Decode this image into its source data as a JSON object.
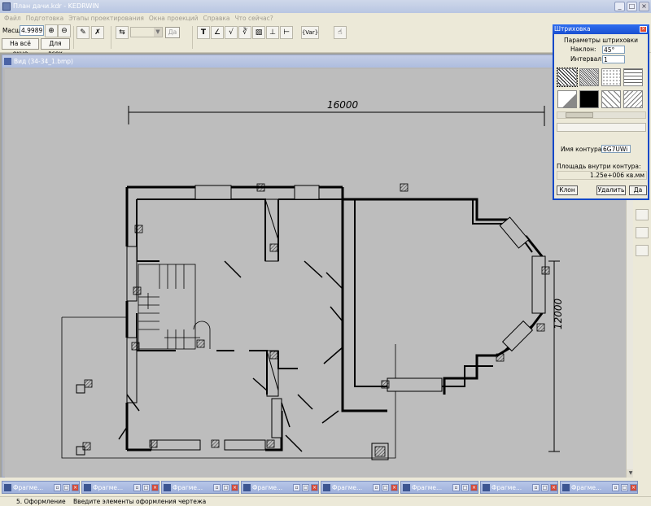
{
  "window": {
    "title": "План дачи.kdr - KEDRWIN"
  },
  "menu": [
    "Файл",
    "Подготовка",
    "Этапы проектирования",
    "Окна проекций",
    "Справка",
    "Что сейчас?"
  ],
  "toolbar": {
    "scale_label": "Масшт",
    "scale_value": "4.9989",
    "on_all_window": "На всё окно",
    "for_all": "Для всех",
    "yes_label": "Да",
    "var_label": "{Var}"
  },
  "document": {
    "title": "Вид (34-34_1.bmp)",
    "dim_horizontal": "16000",
    "dim_vertical": "12000"
  },
  "hatch_dialog": {
    "title": "Штриховка",
    "params_title": "Параметры штриховки",
    "slope_label": "Наклон:",
    "slope_value": "45°",
    "interval_label": "Интервал:",
    "interval_value": "1",
    "contour_name_label": "Имя контура:",
    "contour_name_value": "6G7UWi",
    "area_label": "Площадь внутри контура:",
    "area_value": "1.25e+006 кв.мм",
    "clone_button": "Клон",
    "delete_button": "Удалить",
    "yes_button": "Да"
  },
  "taskbar": {
    "items": [
      "Фрагме...",
      "Фрагме...",
      "Фрагме...",
      "Фрагме...",
      "Фрагме...",
      "Фрагме...",
      "Фрагме...",
      "Фрагме..."
    ]
  },
  "status": {
    "stage": "5. Оформление",
    "hint": "Введите элементы оформления чертежа"
  }
}
